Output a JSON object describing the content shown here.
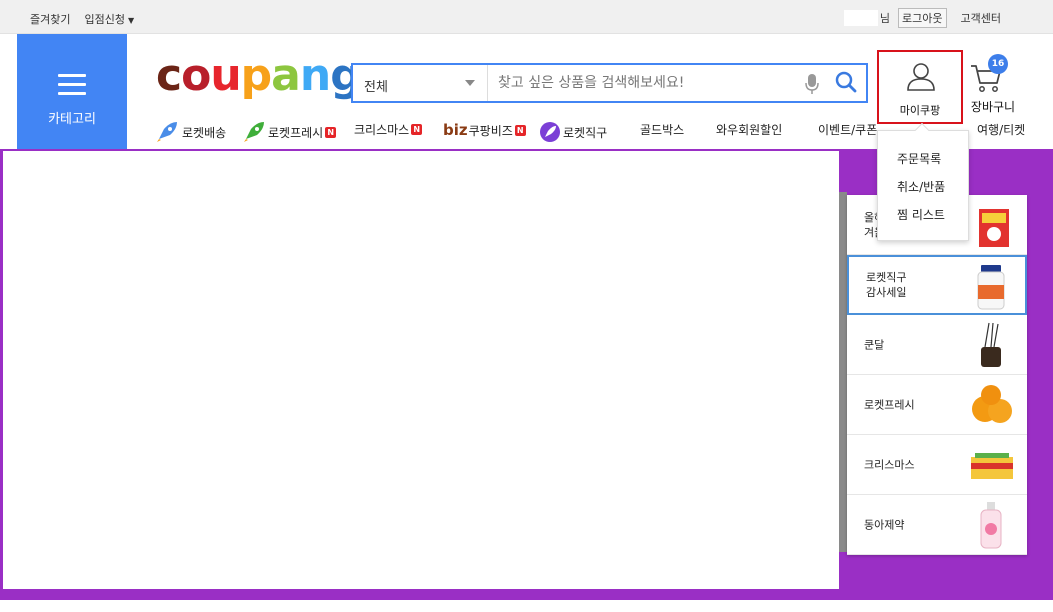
{
  "topbar": {
    "bookmark": "즐겨찾기",
    "seller_apply": "입점신청",
    "user_suffix": "님",
    "logout": "로그아웃",
    "customer_center": "고객센터"
  },
  "header": {
    "category_label": "카테고리",
    "logo_letters": [
      "c",
      "o",
      "u",
      "p",
      "a",
      "n",
      "g"
    ],
    "search": {
      "scope": "전체",
      "placeholder": "찾고 싶은 상품을 검색해보세요!"
    },
    "mycoupang_label": "마이쿠팡",
    "cart_label": "장바구니",
    "cart_count": "16"
  },
  "nav": {
    "items": [
      {
        "label": "로켓배송",
        "icon": "rocket-blue-icon"
      },
      {
        "label": "로켓프레시",
        "icon": "rocket-green-icon",
        "badge": "N"
      },
      {
        "label": "크리스마스",
        "badge": "N"
      },
      {
        "prefix": "biz",
        "label": "쿠팡비즈",
        "badge": "N"
      },
      {
        "label": "로켓직구",
        "icon": "rocket-purple-icon"
      },
      {
        "label": "골드박스"
      },
      {
        "label": "와우회원할인"
      },
      {
        "label": "이벤트/쿠폰"
      },
      {
        "label": "여행/티켓"
      }
    ]
  },
  "dropdown": {
    "items": [
      "주문목록",
      "취소/반품",
      "찜 리스트"
    ]
  },
  "panel": {
    "items": [
      {
        "line1": "올해",
        "line2": "겨울"
      },
      {
        "line1": "로켓직구",
        "line2": "감사세일"
      },
      {
        "line1": "쿤달",
        "line2": ""
      },
      {
        "line1": "로켓프레시",
        "line2": ""
      },
      {
        "line1": "크리스마스",
        "line2": ""
      },
      {
        "line1": "동아제약",
        "line2": ""
      }
    ]
  },
  "colors": {
    "brand_blue": "#4285f4",
    "hero_purple": "#9a2fc5",
    "highlight_red": "#d8121b",
    "badge_red": "#e52528"
  }
}
